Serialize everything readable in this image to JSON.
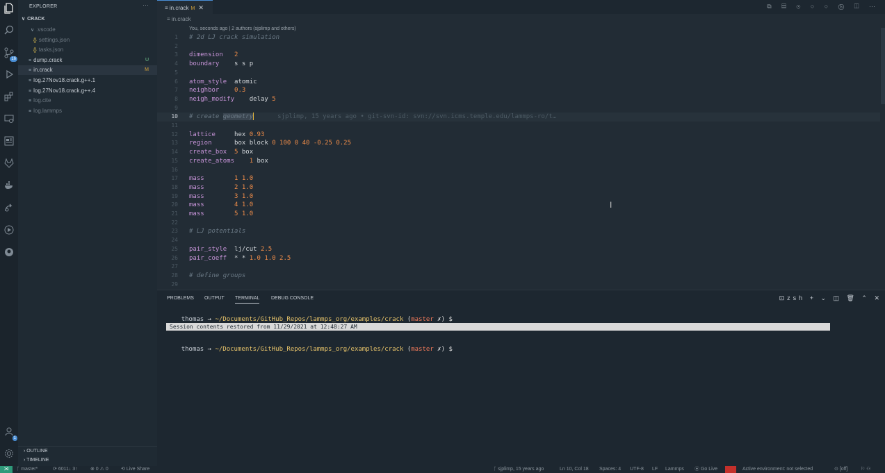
{
  "activity": {
    "items": [
      "files-icon",
      "search-icon",
      "source-control-icon",
      "run-debug-icon",
      "extensions-icon",
      "remote-explorer-icon",
      "preview-icon",
      "gitlab-icon",
      "docker-icon",
      "live-share-icon",
      "run-icon",
      "github-icon"
    ],
    "scm_badge": "16",
    "account_badge": "1"
  },
  "explorer": {
    "title": "EXPLORER",
    "more": "···",
    "root": "CRACK",
    "items": [
      {
        "label": ".vscode",
        "status": "",
        "icon": "∨"
      },
      {
        "label": "settings.json",
        "status": "",
        "icon": "{}"
      },
      {
        "label": "tasks.json",
        "status": "",
        "icon": "{}"
      },
      {
        "label": "dump.crack",
        "status": "U",
        "icon": "≡"
      },
      {
        "label": "in.crack",
        "status": "M",
        "icon": "≡"
      },
      {
        "label": "log.27Nov18.crack.g++.1",
        "status": "",
        "icon": "≡"
      },
      {
        "label": "log.27Nov18.crack.g++.4",
        "status": "",
        "icon": "≡"
      },
      {
        "label": "log.cite",
        "status": "",
        "icon": "≡"
      },
      {
        "label": "log.lammps",
        "status": "",
        "icon": "≡"
      }
    ],
    "outline": "OUTLINE",
    "timeline": "TIMELINE"
  },
  "editor": {
    "tab_label": "in.crack",
    "tab_status": "M",
    "breadcrumb": "in.crack",
    "blame_header": "You, seconds ago | 2 authors (sjplimp and others)",
    "inline_blame": "sjplimp, 15 years ago • git-svn-id: svn://svn.icms.temple.edu/lammps-ro/t…",
    "lines": [
      {
        "n": "1",
        "a": "# 2d LJ crack simulation",
        "b": "",
        "c": ""
      },
      {
        "n": "2",
        "a": "",
        "b": "",
        "c": ""
      },
      {
        "n": "3",
        "a": "dimension",
        "b": "   ",
        "c": "2"
      },
      {
        "n": "4",
        "a": "boundary",
        "b": "    s s p",
        "c": ""
      },
      {
        "n": "5",
        "a": "",
        "b": "",
        "c": ""
      },
      {
        "n": "6",
        "a": "atom_style",
        "b": "  atomic",
        "c": ""
      },
      {
        "n": "7",
        "a": "neighbor",
        "b": "    ",
        "c": "0.3"
      },
      {
        "n": "8",
        "a": "neigh_modify",
        "b": "    delay ",
        "c": "5"
      },
      {
        "n": "9",
        "a": "",
        "b": "",
        "c": ""
      },
      {
        "n": "10",
        "a": "# create ",
        "b": "geometry",
        "c": ""
      },
      {
        "n": "11",
        "a": "",
        "b": "",
        "c": ""
      },
      {
        "n": "12",
        "a": "lattice",
        "b": "     hex ",
        "c": "0.93"
      },
      {
        "n": "13",
        "a": "region",
        "b": "      box block ",
        "c": "0 100 0 40 -0.25 0.25"
      },
      {
        "n": "14",
        "a": "create_box",
        "b": "  ",
        "c": "5"
      },
      {
        "n": "15",
        "a": "create_atoms",
        "b": "    ",
        "c": "1"
      },
      {
        "n": "16",
        "a": "",
        "b": "",
        "c": ""
      },
      {
        "n": "17",
        "a": "mass",
        "b": "        ",
        "c": "1 1.0"
      },
      {
        "n": "18",
        "a": "mass",
        "b": "        ",
        "c": "2 1.0"
      },
      {
        "n": "19",
        "a": "mass",
        "b": "        ",
        "c": "3 1.0"
      },
      {
        "n": "20",
        "a": "mass",
        "b": "        ",
        "c": "4 1.0"
      },
      {
        "n": "21",
        "a": "mass",
        "b": "        ",
        "c": "5 1.0"
      },
      {
        "n": "22",
        "a": "",
        "b": "",
        "c": ""
      },
      {
        "n": "23",
        "a": "# LJ potentials",
        "b": "",
        "c": ""
      },
      {
        "n": "24",
        "a": "",
        "b": "",
        "c": ""
      },
      {
        "n": "25",
        "a": "pair_style",
        "b": "  lj/cut ",
        "c": "2.5"
      },
      {
        "n": "26",
        "a": "pair_coeff",
        "b": "  * * ",
        "c": "1.0 1.0 2.5"
      },
      {
        "n": "27",
        "a": "",
        "b": "",
        "c": ""
      },
      {
        "n": "28",
        "a": "# define groups",
        "b": "",
        "c": ""
      },
      {
        "n": "29",
        "a": "",
        "b": "",
        "c": ""
      }
    ],
    "suffix": {
      "14": " box",
      "15": " box"
    }
  },
  "panel": {
    "tabs": [
      "PROBLEMS",
      "OUTPUT",
      "TERMINAL",
      "DEBUG CONSOLE"
    ],
    "active_tab": "TERMINAL",
    "shell": "zsh",
    "prompt": {
      "user": "thomas",
      "arrow": " → ",
      "path": "~/Documents/GitHub_Repos/lammps_org/examples/crack",
      "open": " (",
      "branch": "master",
      "dirty": " ✗",
      "close": ") $"
    },
    "restored": "Session contents restored from 11/29/2021 at 12:48:27 AM"
  },
  "status": {
    "branch": "master*",
    "sync": "6011↓ 3↑",
    "problems": "⊗ 0 ⚠ 0",
    "live_share": "Live Share",
    "blame": "sjplimp, 15 years ago",
    "position": "Ln 10, Col 18",
    "spaces": "Spaces: 4",
    "encoding": "UTF-8",
    "eol": "LF",
    "language": "Lammps",
    "golive": "Go Live",
    "env": "Active environment: not selected",
    "off": "[off]"
  },
  "colors": {
    "accent": "#4a8fd6",
    "keyword": "#c794d8",
    "number": "#f08d49",
    "path": "#e8c46a",
    "branch": "#f07a5a"
  }
}
